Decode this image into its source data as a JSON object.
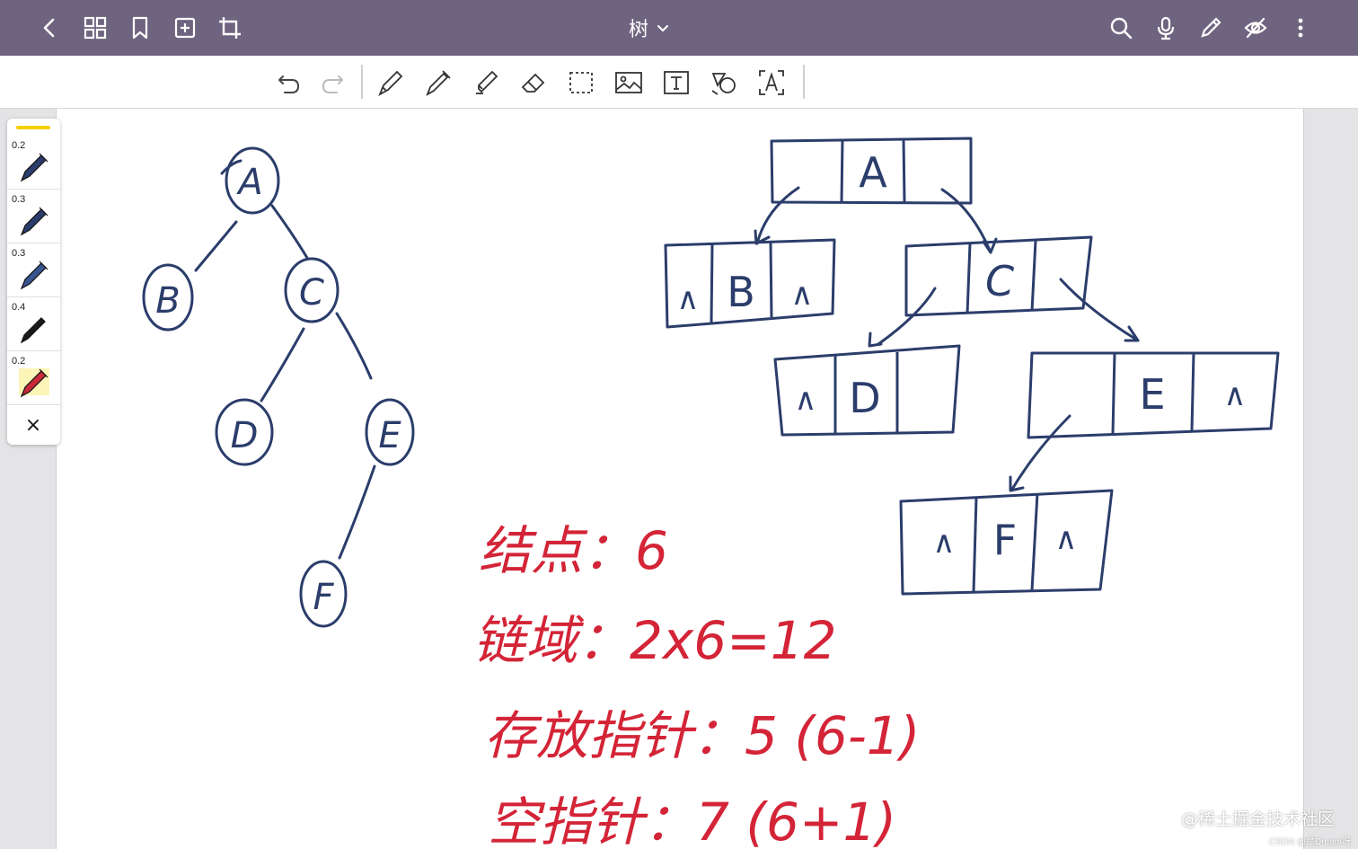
{
  "titlebar": {
    "title": "树",
    "buttons": [
      "back-icon",
      "grid-icon",
      "bookmark-icon",
      "add-page-icon",
      "crop-icon"
    ],
    "right_buttons": [
      "search-icon",
      "microphone-icon",
      "pen-icon",
      "hide-icon",
      "more-icon"
    ]
  },
  "toolbar": {
    "tools": [
      "undo",
      "redo",
      "fountain-pen",
      "ballpoint-pen",
      "highlighter",
      "eraser",
      "lasso-select",
      "image",
      "text-box",
      "shape",
      "ocr-text"
    ]
  },
  "pen_panel": {
    "accent": "#f5d000",
    "pens": [
      {
        "size": "0.2",
        "color": "#2b3d6b"
      },
      {
        "size": "0.3",
        "color": "#2b3d6b"
      },
      {
        "size": "0.3",
        "color": "#2b3d6b"
      },
      {
        "size": "0.4",
        "color": "#1a1a1a"
      },
      {
        "size": "0.2",
        "color": "#c72a3b"
      }
    ],
    "close": "×"
  },
  "notes": {
    "tree_nodes": [
      "A",
      "B",
      "C",
      "D",
      "E",
      "F"
    ],
    "list_nodes": [
      {
        "left": "",
        "data": "A",
        "right": ""
      },
      {
        "left": "∧",
        "data": "B",
        "right": "∧"
      },
      {
        "left": "",
        "data": "C",
        "right": ""
      },
      {
        "left": "∧",
        "data": "D",
        "right": ""
      },
      {
        "left": "",
        "data": "E",
        "right": "∧"
      },
      {
        "left": "∧",
        "data": "F",
        "right": "∧"
      }
    ],
    "lines": [
      "结点：6",
      "链域：2x6=12",
      "存放指针：5 (6-1)",
      "空指针：7 (6+1)"
    ],
    "ink_blue": "#2b3d6b",
    "ink_red": "#d42437"
  },
  "watermark": {
    "main": "@稀土掘金技术社区",
    "sub": "CSDN @是Dream呀"
  }
}
